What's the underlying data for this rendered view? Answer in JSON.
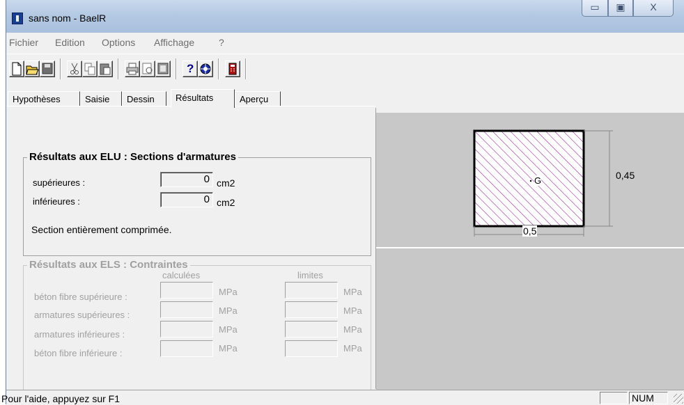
{
  "window": {
    "title": "sans nom - BaelR",
    "min_glyph": "▭",
    "max_glyph": "▣",
    "close_glyph": "X"
  },
  "menu": [
    "Fichier",
    "Edition",
    "Options",
    "Affichage",
    "?"
  ],
  "toolbar": {
    "icons": [
      "new-file-icon",
      "open-folder-icon",
      "save-icon",
      "cut-icon",
      "copy-icon",
      "paste-icon",
      "print-icon",
      "print-preview-icon",
      "properties-icon",
      "help-icon",
      "context-help-icon",
      "calculate-icon"
    ],
    "help_glyph": "?"
  },
  "tabs": [
    "Hypothèses",
    "Saisie",
    "Dessin",
    "Résultats",
    "Aperçu"
  ],
  "active_tab": "Résultats",
  "elu": {
    "title": "Résultats aux ELU : Sections d'armatures",
    "superieures_label": "supérieures :",
    "superieures_value": "0",
    "inferieures_label": "inférieures :",
    "inferieures_value": "0",
    "unit": "cm2",
    "message": "Section entièrement comprimée."
  },
  "els": {
    "title": "Résultats aux ELS : Contraintes",
    "col_calculees": "calculées",
    "col_limites": "limites",
    "unit": "MPa",
    "rows": [
      {
        "label": "béton fibre supérieure :"
      },
      {
        "label": "armatures supérieures :"
      },
      {
        "label": "armatures inférieures :"
      },
      {
        "label": "béton fibre inférieure :"
      }
    ]
  },
  "section_drawing": {
    "height_label": "0,45",
    "width_label": "0,5",
    "centroid_label": "G",
    "hatch_color": "#9b2fa0"
  },
  "status": {
    "text": "Pour l'aide, appuyez sur F1",
    "num": "NUM"
  }
}
